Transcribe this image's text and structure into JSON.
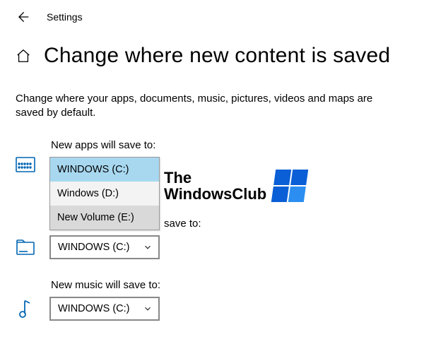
{
  "topbar": {
    "title": "Settings"
  },
  "header": {
    "page_title": "Change where new content is saved"
  },
  "description": "Change where your apps, documents, music, pictures, videos and maps are saved by default.",
  "settings": {
    "apps": {
      "label": "New apps will save to:",
      "value": "WINDOWS (C:)",
      "dropdown": {
        "open": true,
        "items": [
          {
            "label": "WINDOWS (C:)",
            "state": "selected"
          },
          {
            "label": "Windows (D:)",
            "state": "normal"
          },
          {
            "label": "New Volume (E:)",
            "state": "hover"
          }
        ]
      }
    },
    "documents_partial": {
      "label_fragment": "save to:",
      "value": "WINDOWS (C:)"
    },
    "music": {
      "label": "New music will save to:",
      "value": "WINDOWS (C:)"
    }
  },
  "watermark": {
    "line1": "The",
    "line2": "WindowsClub"
  }
}
